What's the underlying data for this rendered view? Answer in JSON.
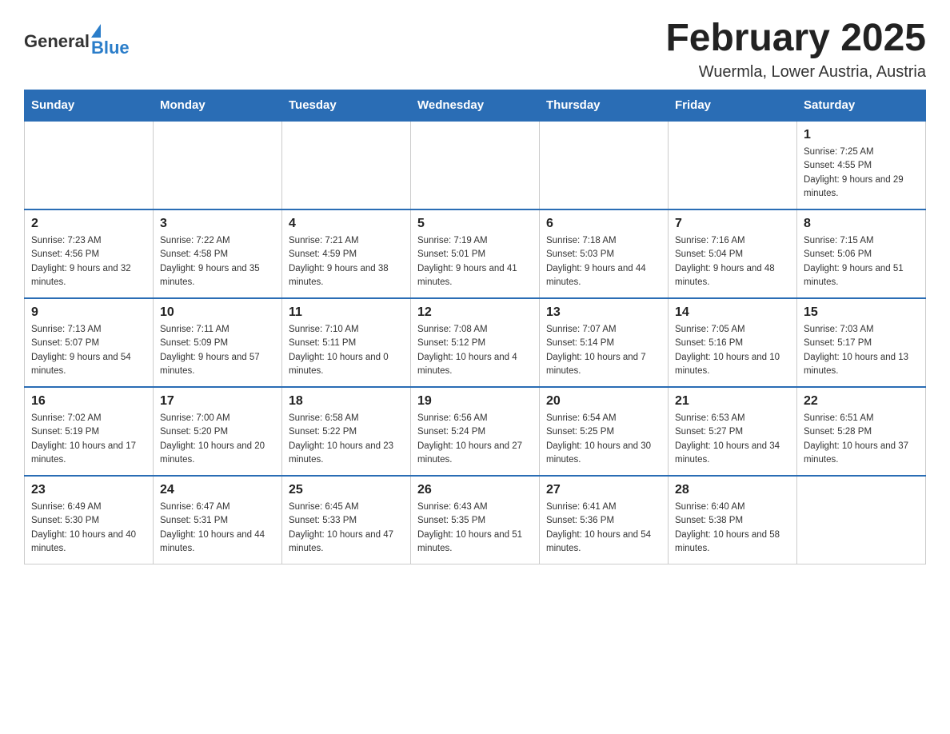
{
  "header": {
    "logo": {
      "general": "General",
      "blue": "Blue"
    },
    "title": "February 2025",
    "subtitle": "Wuermla, Lower Austria, Austria"
  },
  "weekdays": [
    "Sunday",
    "Monday",
    "Tuesday",
    "Wednesday",
    "Thursday",
    "Friday",
    "Saturday"
  ],
  "weeks": [
    [
      {
        "day": "",
        "info": ""
      },
      {
        "day": "",
        "info": ""
      },
      {
        "day": "",
        "info": ""
      },
      {
        "day": "",
        "info": ""
      },
      {
        "day": "",
        "info": ""
      },
      {
        "day": "",
        "info": ""
      },
      {
        "day": "1",
        "info": "Sunrise: 7:25 AM\nSunset: 4:55 PM\nDaylight: 9 hours and 29 minutes."
      }
    ],
    [
      {
        "day": "2",
        "info": "Sunrise: 7:23 AM\nSunset: 4:56 PM\nDaylight: 9 hours and 32 minutes."
      },
      {
        "day": "3",
        "info": "Sunrise: 7:22 AM\nSunset: 4:58 PM\nDaylight: 9 hours and 35 minutes."
      },
      {
        "day": "4",
        "info": "Sunrise: 7:21 AM\nSunset: 4:59 PM\nDaylight: 9 hours and 38 minutes."
      },
      {
        "day": "5",
        "info": "Sunrise: 7:19 AM\nSunset: 5:01 PM\nDaylight: 9 hours and 41 minutes."
      },
      {
        "day": "6",
        "info": "Sunrise: 7:18 AM\nSunset: 5:03 PM\nDaylight: 9 hours and 44 minutes."
      },
      {
        "day": "7",
        "info": "Sunrise: 7:16 AM\nSunset: 5:04 PM\nDaylight: 9 hours and 48 minutes."
      },
      {
        "day": "8",
        "info": "Sunrise: 7:15 AM\nSunset: 5:06 PM\nDaylight: 9 hours and 51 minutes."
      }
    ],
    [
      {
        "day": "9",
        "info": "Sunrise: 7:13 AM\nSunset: 5:07 PM\nDaylight: 9 hours and 54 minutes."
      },
      {
        "day": "10",
        "info": "Sunrise: 7:11 AM\nSunset: 5:09 PM\nDaylight: 9 hours and 57 minutes."
      },
      {
        "day": "11",
        "info": "Sunrise: 7:10 AM\nSunset: 5:11 PM\nDaylight: 10 hours and 0 minutes."
      },
      {
        "day": "12",
        "info": "Sunrise: 7:08 AM\nSunset: 5:12 PM\nDaylight: 10 hours and 4 minutes."
      },
      {
        "day": "13",
        "info": "Sunrise: 7:07 AM\nSunset: 5:14 PM\nDaylight: 10 hours and 7 minutes."
      },
      {
        "day": "14",
        "info": "Sunrise: 7:05 AM\nSunset: 5:16 PM\nDaylight: 10 hours and 10 minutes."
      },
      {
        "day": "15",
        "info": "Sunrise: 7:03 AM\nSunset: 5:17 PM\nDaylight: 10 hours and 13 minutes."
      }
    ],
    [
      {
        "day": "16",
        "info": "Sunrise: 7:02 AM\nSunset: 5:19 PM\nDaylight: 10 hours and 17 minutes."
      },
      {
        "day": "17",
        "info": "Sunrise: 7:00 AM\nSunset: 5:20 PM\nDaylight: 10 hours and 20 minutes."
      },
      {
        "day": "18",
        "info": "Sunrise: 6:58 AM\nSunset: 5:22 PM\nDaylight: 10 hours and 23 minutes."
      },
      {
        "day": "19",
        "info": "Sunrise: 6:56 AM\nSunset: 5:24 PM\nDaylight: 10 hours and 27 minutes."
      },
      {
        "day": "20",
        "info": "Sunrise: 6:54 AM\nSunset: 5:25 PM\nDaylight: 10 hours and 30 minutes."
      },
      {
        "day": "21",
        "info": "Sunrise: 6:53 AM\nSunset: 5:27 PM\nDaylight: 10 hours and 34 minutes."
      },
      {
        "day": "22",
        "info": "Sunrise: 6:51 AM\nSunset: 5:28 PM\nDaylight: 10 hours and 37 minutes."
      }
    ],
    [
      {
        "day": "23",
        "info": "Sunrise: 6:49 AM\nSunset: 5:30 PM\nDaylight: 10 hours and 40 minutes."
      },
      {
        "day": "24",
        "info": "Sunrise: 6:47 AM\nSunset: 5:31 PM\nDaylight: 10 hours and 44 minutes."
      },
      {
        "day": "25",
        "info": "Sunrise: 6:45 AM\nSunset: 5:33 PM\nDaylight: 10 hours and 47 minutes."
      },
      {
        "day": "26",
        "info": "Sunrise: 6:43 AM\nSunset: 5:35 PM\nDaylight: 10 hours and 51 minutes."
      },
      {
        "day": "27",
        "info": "Sunrise: 6:41 AM\nSunset: 5:36 PM\nDaylight: 10 hours and 54 minutes."
      },
      {
        "day": "28",
        "info": "Sunrise: 6:40 AM\nSunset: 5:38 PM\nDaylight: 10 hours and 58 minutes."
      },
      {
        "day": "",
        "info": ""
      }
    ]
  ]
}
